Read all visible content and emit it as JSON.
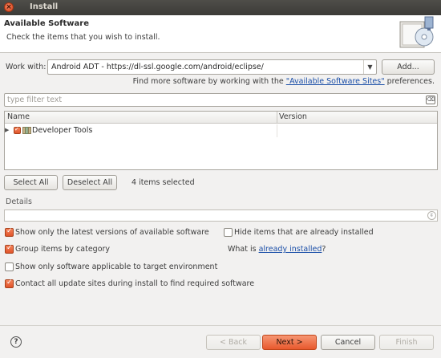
{
  "window": {
    "title": "Install"
  },
  "banner": {
    "heading": "Available Software",
    "description": "Check the items that you wish to install."
  },
  "work_with": {
    "label": "Work with:",
    "value": "Android ADT - https://dl-ssl.google.com/android/eclipse/",
    "add_label": "Add..."
  },
  "sites": {
    "prefix": "Find more software by working with the ",
    "link": "\"Available Software Sites\"",
    "suffix": " preferences."
  },
  "filter": {
    "placeholder": "type filter text"
  },
  "tree": {
    "columns": [
      "Name",
      "Version"
    ],
    "rows": [
      {
        "name": "Developer Tools",
        "version": "",
        "checked": true,
        "expanded": false
      }
    ]
  },
  "selection": {
    "select_all": "Select All",
    "deselect_all": "Deselect All",
    "status": "4 items selected"
  },
  "details": {
    "label": "Details"
  },
  "options": {
    "latest_versions": {
      "label": "Show only the latest versions of available software",
      "checked": true
    },
    "hide_installed": {
      "label": "Hide items that are already installed",
      "checked": false
    },
    "group_by_category": {
      "label": "Group items by category",
      "checked": true
    },
    "what_installed": {
      "prefix": "What is ",
      "link": "already installed",
      "suffix": "?"
    },
    "target_env": {
      "label": "Show only software applicable to target environment",
      "checked": false
    },
    "contact_sites": {
      "label": "Contact all update sites during install to find required software",
      "checked": true
    }
  },
  "footer": {
    "back": "< Back",
    "next": "Next >",
    "cancel": "Cancel",
    "finish": "Finish"
  },
  "colors": {
    "accent": "#e8592e",
    "link": "#1b4fa8",
    "titlebar": "#3c3b37"
  },
  "icons": [
    "close-icon",
    "install-wizard-icon",
    "clear-filter-icon",
    "expander-icon",
    "category-icon",
    "help-icon"
  ]
}
